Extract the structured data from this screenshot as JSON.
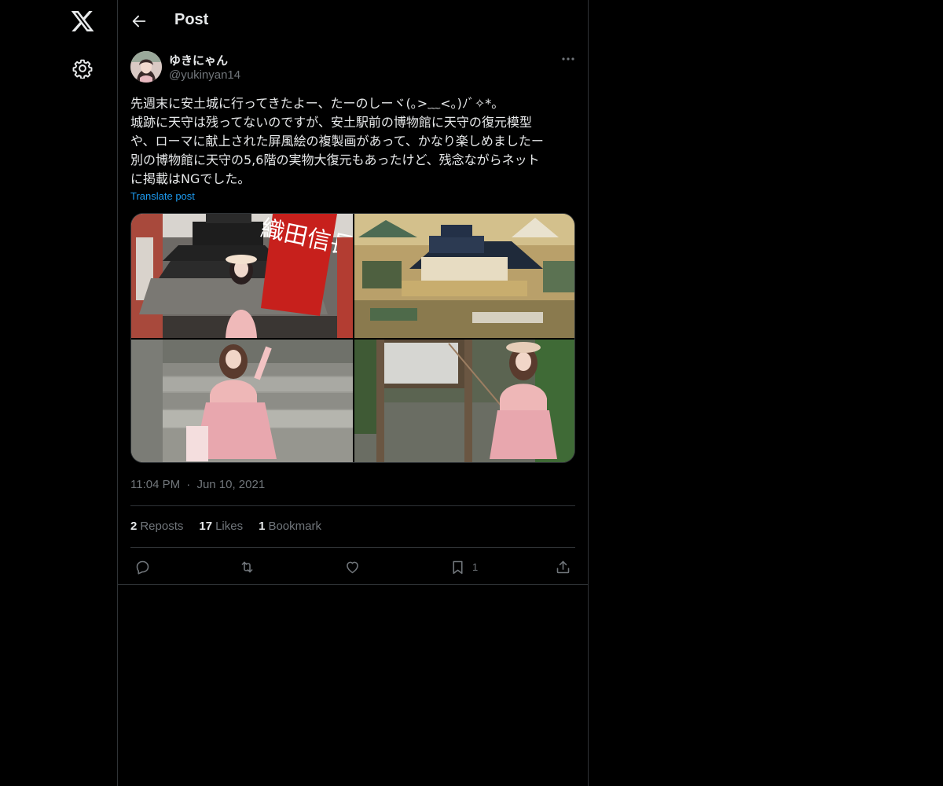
{
  "header": {
    "title": "Post"
  },
  "author": {
    "display_name": "ゆきにゃん",
    "handle": "@yukinyan14"
  },
  "post": {
    "lines": [
      "先週末に安土城に行ってきたよー、たーのしーヾ(｡>﹏<｡)ﾉﾞ✧*。",
      "城跡に天守は残ってないのですが、安土駅前の博物館に天守の復元模型",
      "や、ローマに献上された屏風絵の複製画があって、かなり楽しめましたー",
      "別の博物館に天守の5,6階の実物大復元もあったけど、残念ながらネット",
      "に掲載はNGでした。"
    ],
    "translate_label": "Translate post",
    "banner_text": "織田信長"
  },
  "meta": {
    "time": "11:04 PM",
    "separator": "·",
    "date": "Jun 10, 2021"
  },
  "stats": {
    "reposts_count": "2",
    "reposts_label": "Reposts",
    "likes_count": "17",
    "likes_label": "Likes",
    "bookmarks_count": "1",
    "bookmarks_label": "Bookmark"
  },
  "actions": {
    "reply_icon": "reply-icon",
    "repost_icon": "repost-icon",
    "like_icon": "heart-icon",
    "bookmark_icon": "bookmark-icon",
    "bookmark_count": "1",
    "share_icon": "share-icon"
  },
  "colors": {
    "background": "#000000",
    "text": "#e7e9ea",
    "muted": "#71767b",
    "link": "#1d9bf0",
    "border": "#2f3336"
  }
}
